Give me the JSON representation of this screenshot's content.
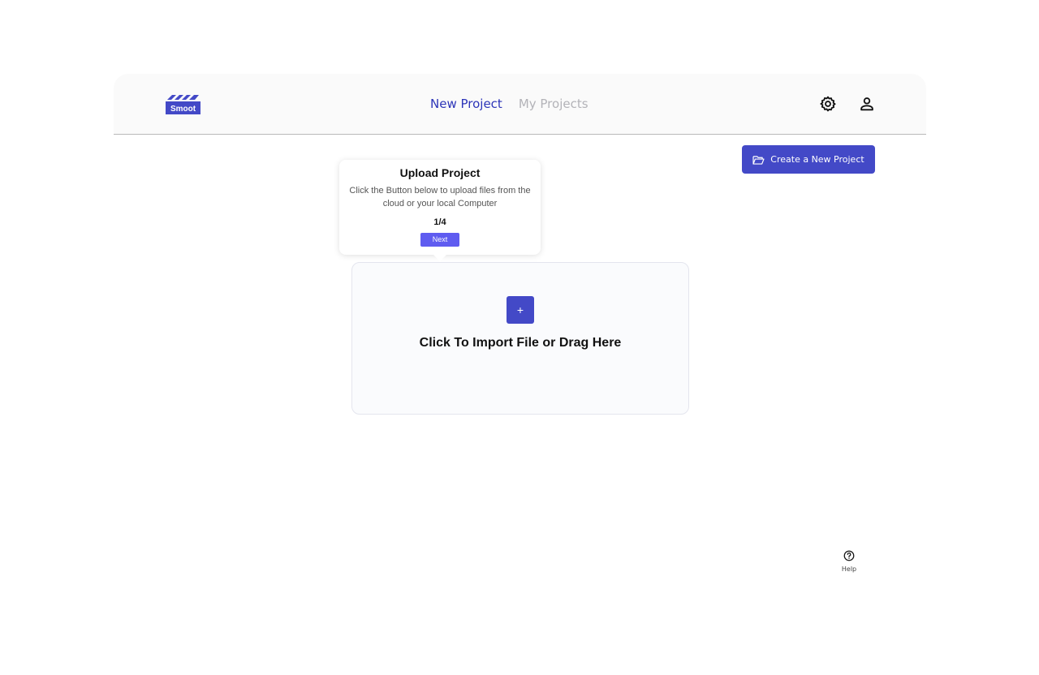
{
  "header": {
    "logo_text": "Smoot",
    "tabs": [
      {
        "label": "New Project",
        "active": true
      },
      {
        "label": "My Projects",
        "active": false
      }
    ],
    "settings_icon": "gear-icon",
    "profile_icon": "user-icon"
  },
  "toolbar": {
    "create_label": "Create a New Project",
    "create_icon": "folder-open-icon"
  },
  "tooltip": {
    "title": "Upload Project",
    "body": "Click the Button below to upload files from the cloud or your local Computer",
    "step": "1/4",
    "next_label": "Next"
  },
  "dropzone": {
    "plus": "+",
    "text": "Click To Import File or Drag Here"
  },
  "help": {
    "label": "Help",
    "icon": "question-circle-icon"
  },
  "colors": {
    "accent": "#4349c7",
    "active_tab": "#2d35b8",
    "inactive_tab": "#b3b3b8",
    "next_button": "#5f5cf0"
  }
}
